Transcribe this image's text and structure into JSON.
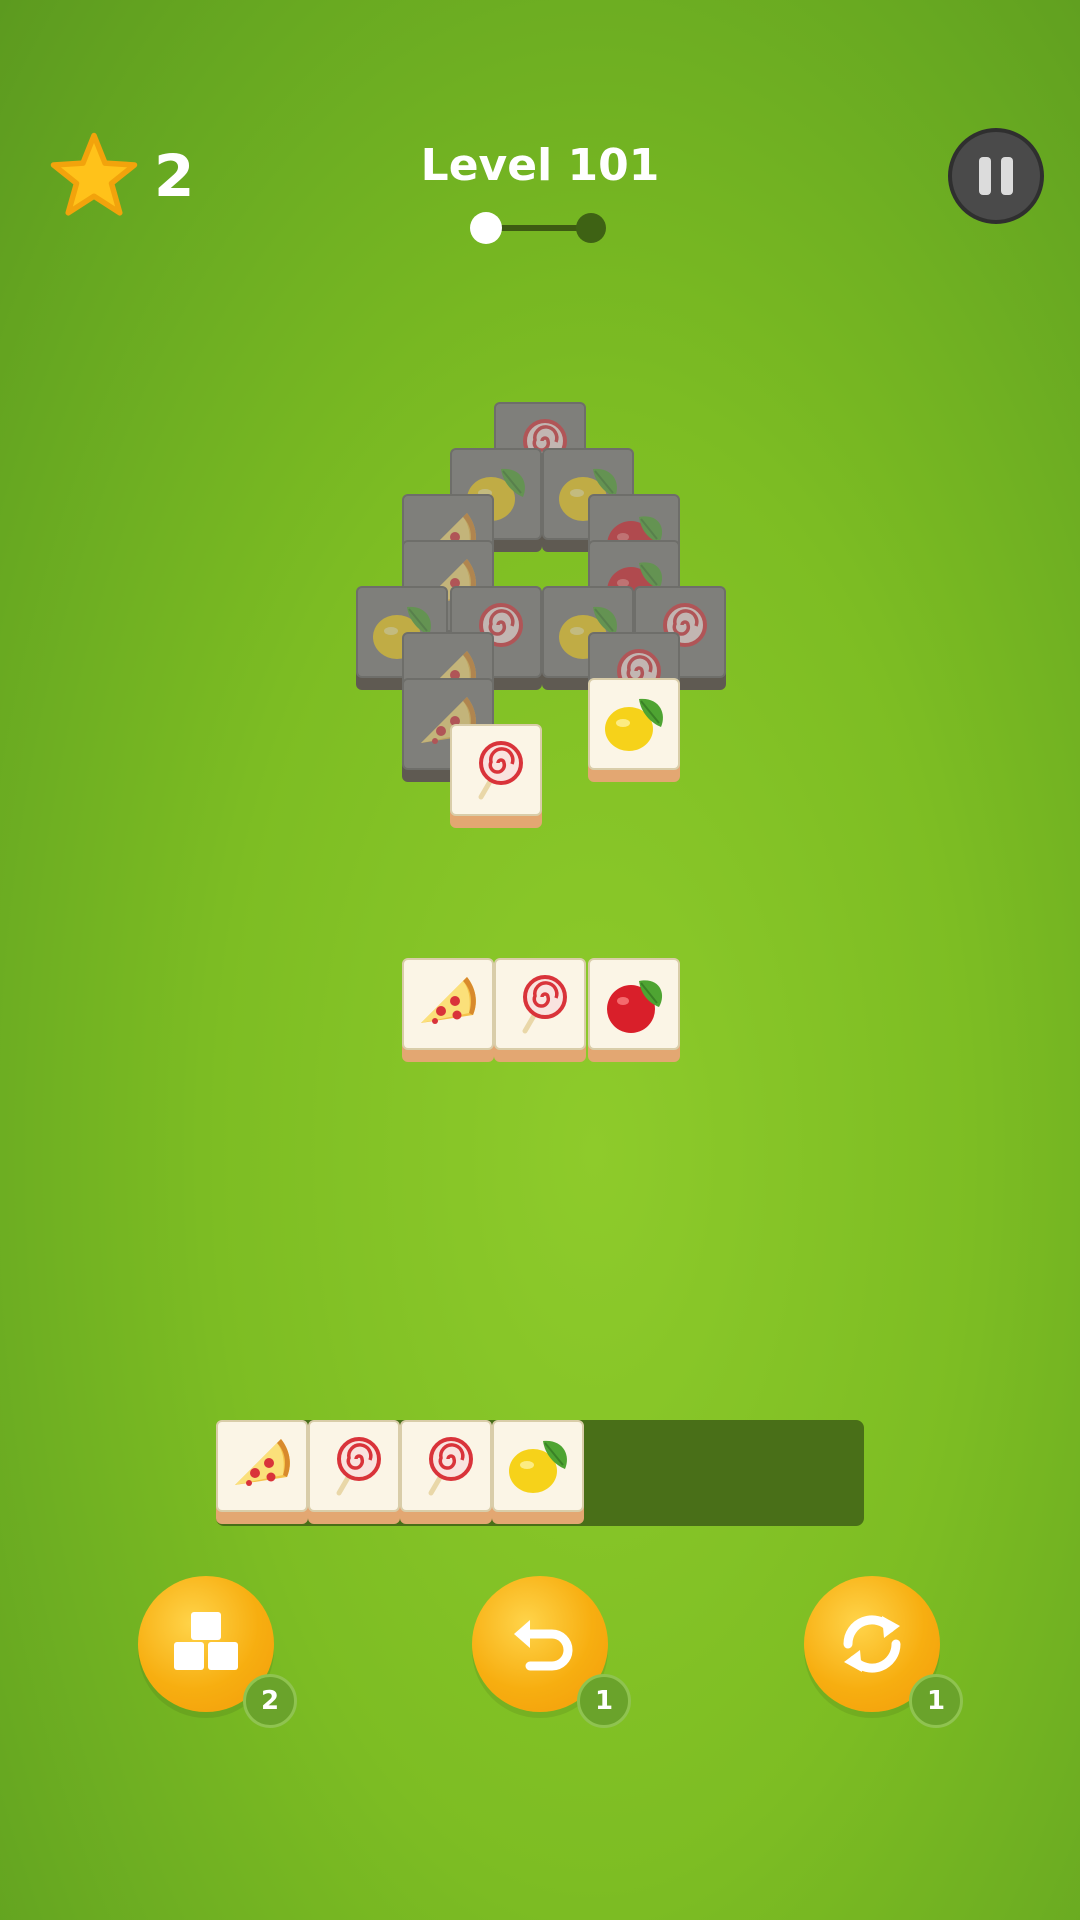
{
  "hud": {
    "stars": "2",
    "level_title": "Level 101",
    "level_progress_stages": 2,
    "level_progress_current": 1
  },
  "icons": {
    "star": "star-icon",
    "pause": "pause-icon",
    "shuffle_tiles": "tiles-stack-icon",
    "undo": "undo-icon",
    "refresh": "refresh-icon"
  },
  "board": {
    "tiles": [
      {
        "symbol": "lollipop",
        "state": "locked"
      },
      {
        "symbol": "lemon",
        "state": "locked"
      },
      {
        "symbol": "lemon",
        "state": "locked"
      },
      {
        "symbol": "pizza",
        "state": "locked"
      },
      {
        "symbol": "apple",
        "state": "locked"
      },
      {
        "symbol": "pizza",
        "state": "locked"
      },
      {
        "symbol": "apple",
        "state": "locked"
      },
      {
        "symbol": "lemon",
        "state": "locked"
      },
      {
        "symbol": "lollipop",
        "state": "locked"
      },
      {
        "symbol": "lemon",
        "state": "locked"
      },
      {
        "symbol": "lollipop",
        "state": "locked"
      },
      {
        "symbol": "pizza",
        "state": "locked"
      },
      {
        "symbol": "lollipop",
        "state": "locked"
      },
      {
        "symbol": "pizza",
        "state": "locked"
      },
      {
        "symbol": "lemon",
        "state": "open"
      },
      {
        "symbol": "lollipop",
        "state": "open"
      },
      {
        "symbol": "pizza",
        "state": "open"
      },
      {
        "symbol": "lollipop",
        "state": "open"
      },
      {
        "symbol": "apple",
        "state": "open"
      }
    ]
  },
  "tray": {
    "capacity": 7,
    "tiles": [
      "pizza",
      "lollipop",
      "lollipop",
      "lemon"
    ]
  },
  "boosters": [
    {
      "name": "shuffle-tiles",
      "icon": "tiles-stack-icon",
      "count": "2"
    },
    {
      "name": "undo",
      "icon": "undo-icon",
      "count": "1"
    },
    {
      "name": "refresh",
      "icon": "refresh-icon",
      "count": "1"
    }
  ],
  "colors": {
    "background": "#7dbd23",
    "tile_face": "#fbf5e6",
    "tile_base": "#e3a772",
    "tray": "#496f18",
    "booster": "#f7ae10",
    "badge": "#6aa32b"
  }
}
